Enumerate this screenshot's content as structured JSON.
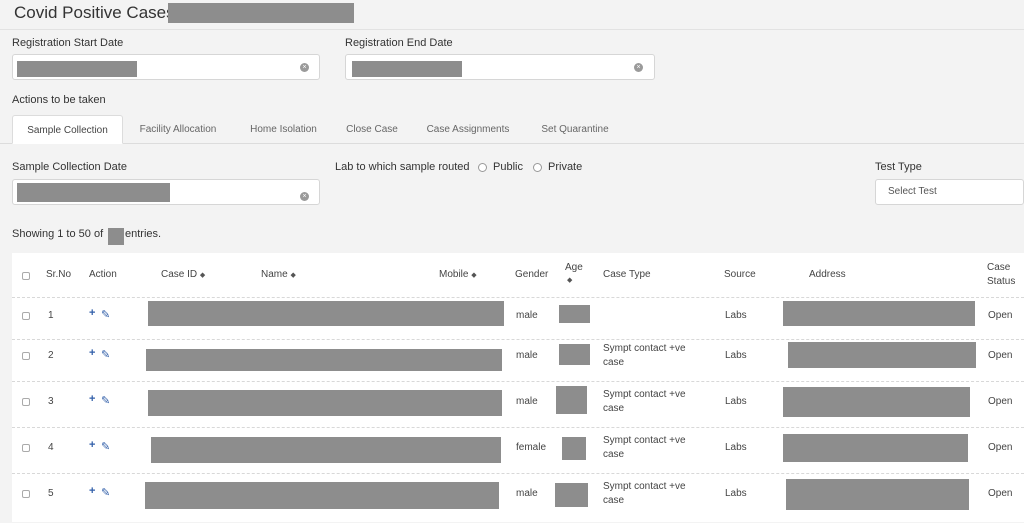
{
  "header": {
    "title": "Covid Positive Cases"
  },
  "filters": {
    "registration_start_label": "Registration Start Date",
    "registration_end_label": "Registration End Date",
    "clear_glyph": "×"
  },
  "actions_label": "Actions to be taken",
  "tabs": [
    {
      "label": "Sample Collection",
      "active": true
    },
    {
      "label": "Facility Allocation"
    },
    {
      "label": "Home Isolation"
    },
    {
      "label": "Close Case"
    },
    {
      "label": "Case Assignments"
    },
    {
      "label": "Set Quarantine"
    }
  ],
  "sample": {
    "collection_date_label": "Sample Collection Date",
    "lab_label": "Lab to which sample routed",
    "lab_options": [
      "Public",
      "Private"
    ],
    "test_type_label": "Test Type",
    "test_type_placeholder": "Select Test"
  },
  "entries": {
    "prefix": "Showing 1 to 50 of",
    "suffix": "entries."
  },
  "table": {
    "headers": {
      "srno": "Sr.No",
      "action": "Action",
      "case_id": "Case ID",
      "name": "Name",
      "mobile": "Mobile",
      "gender": "Gender",
      "age": "Age",
      "case_type": "Case Type",
      "source": "Source",
      "address": "Address",
      "case_status_1": "Case",
      "case_status_2": "Status"
    },
    "sort_glyph": "◆",
    "action_add_glyph": "+",
    "action_edit_glyph": "✎",
    "rows": [
      {
        "sr": "1",
        "gender": "male",
        "case_type_1": "",
        "case_type_2": "",
        "source": "Labs",
        "status": "Open"
      },
      {
        "sr": "2",
        "gender": "male",
        "case_type_1": "Sympt contact +ve",
        "case_type_2": "case",
        "source": "Labs",
        "status": "Open"
      },
      {
        "sr": "3",
        "gender": "male",
        "case_type_1": "Sympt contact +ve",
        "case_type_2": "case",
        "source": "Labs",
        "status": "Open"
      },
      {
        "sr": "4",
        "gender": "female",
        "case_type_1": "Sympt contact +ve",
        "case_type_2": "case",
        "source": "Labs",
        "status": "Open"
      },
      {
        "sr": "5",
        "gender": "male",
        "case_type_1": "Sympt contact +ve",
        "case_type_2": "case",
        "source": "Labs",
        "status": "Open"
      }
    ]
  }
}
